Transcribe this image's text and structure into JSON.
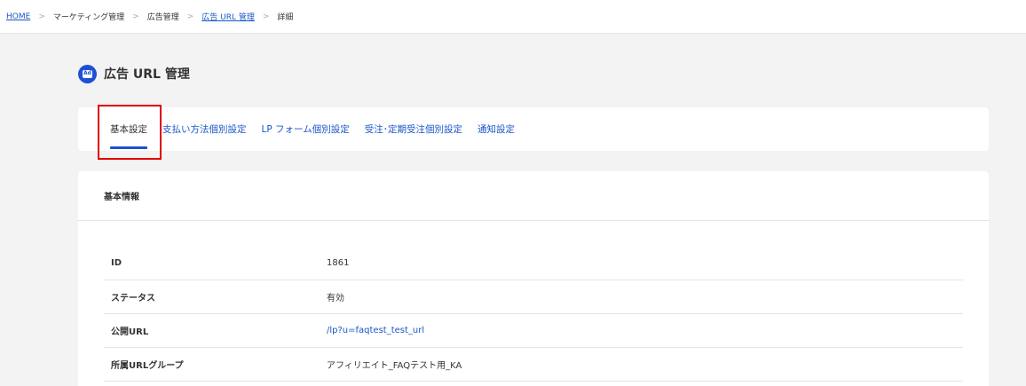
{
  "breadcrumb": {
    "items": [
      "HOME",
      "マーケティング管理",
      "広告管理",
      "広告 URL 管理",
      "詳細"
    ],
    "separator": ">"
  },
  "page": {
    "title": "広告 URL 管理",
    "icon": "ad-icon",
    "icon_text": "Ad"
  },
  "tabs": [
    {
      "label": "基本設定",
      "active": true
    },
    {
      "label": "支払い方法個別設定"
    },
    {
      "label": "LP フォーム個別設定"
    },
    {
      "label": "受注･定期受注個別設定"
    },
    {
      "label": "通知設定"
    }
  ],
  "info": {
    "section_title": "基本情報",
    "rows": [
      {
        "label": "ID",
        "value": "1861"
      },
      {
        "label": "ステータス",
        "value": "有効"
      },
      {
        "label": "公開URL",
        "value": "/lp?u=faqtest_test_url"
      },
      {
        "label": "所属URLグループ",
        "value": "アフィリエイト_FAQテスト用_KA"
      }
    ]
  },
  "colors": {
    "accent": "#1f4fd6",
    "link": "#1a56c8",
    "highlight": "#e00000",
    "background": "#f3f3f3"
  }
}
